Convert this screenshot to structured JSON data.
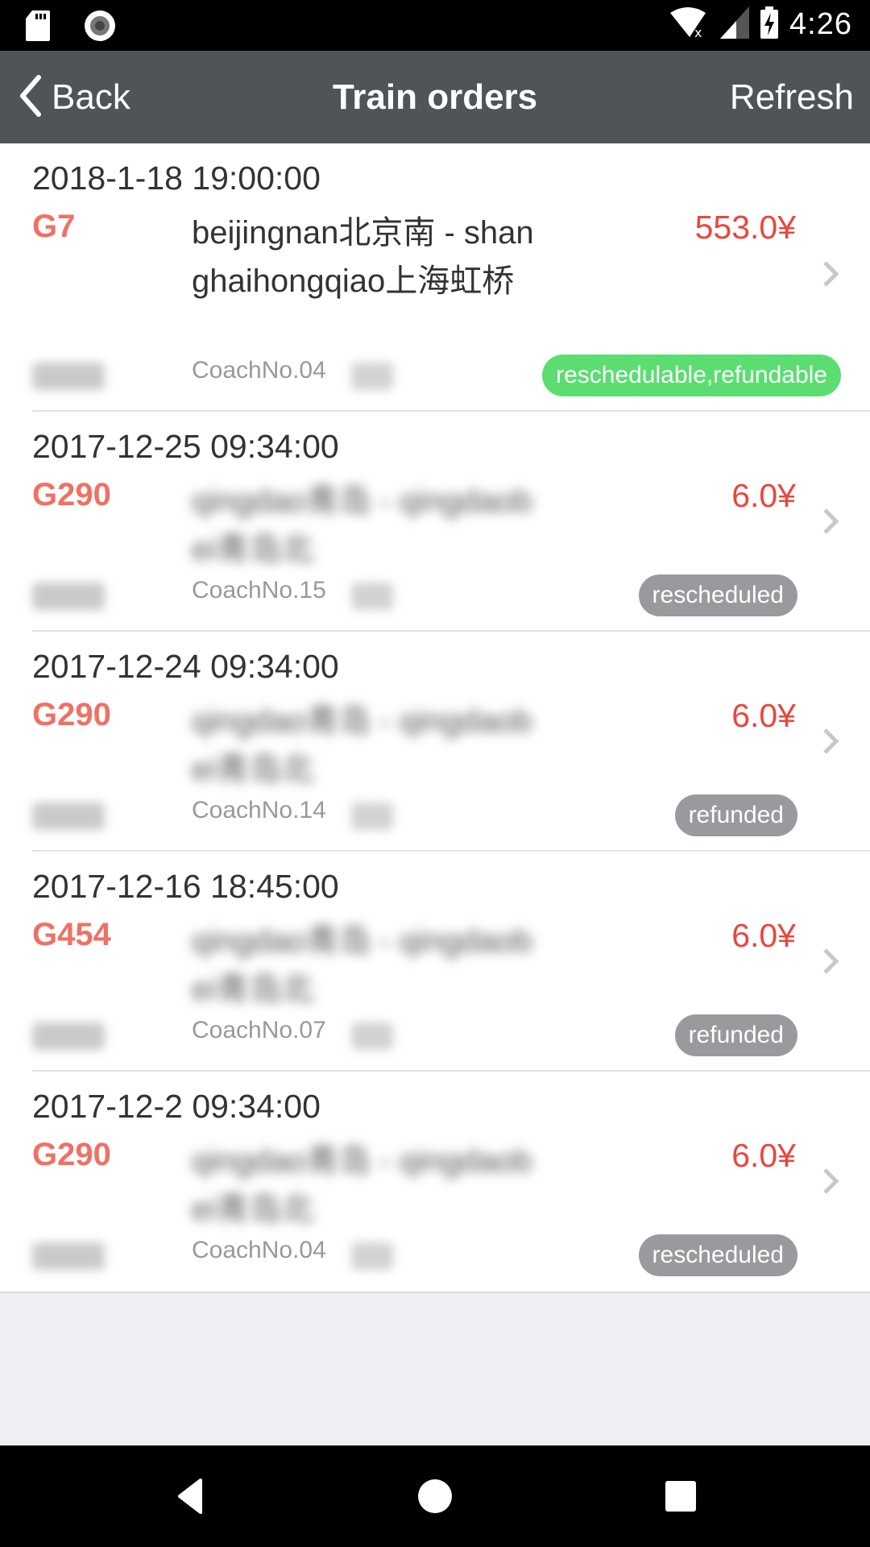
{
  "status_bar": {
    "time": "4:26",
    "icons": [
      "sd-card-icon",
      "record-icon",
      "wifi-off-icon",
      "signal-icon",
      "battery-charging-icon"
    ]
  },
  "header": {
    "back_label": "Back",
    "title": "Train orders",
    "refresh_label": "Refresh"
  },
  "colors": {
    "header_bg": "#4f5458",
    "train_no": "#f07064",
    "price": "#e8473d",
    "badge_green": "#5cdd72",
    "badge_gray": "#999a9e"
  },
  "orders": [
    {
      "datetime": "2018-1-18 19:00:00",
      "train_no": "G7",
      "route": "beijingnan北京南 - shanghaihongqiao上海虹桥",
      "route_blurred": false,
      "price": "553.0¥",
      "coach": "CoachNo.04",
      "status": "reschedulable,refundable",
      "status_color": "green"
    },
    {
      "datetime": "2017-12-25 09:34:00",
      "train_no": "G290",
      "route": "qingdao青岛 - qingdaobei青岛北",
      "route_blurred": true,
      "price": "6.0¥",
      "coach": "CoachNo.15",
      "status": "rescheduled",
      "status_color": "gray"
    },
    {
      "datetime": "2017-12-24 09:34:00",
      "train_no": "G290",
      "route": "qingdao青岛 - qingdaobei青岛北",
      "route_blurred": true,
      "price": "6.0¥",
      "coach": "CoachNo.14",
      "status": "refunded",
      "status_color": "gray"
    },
    {
      "datetime": "2017-12-16 18:45:00",
      "train_no": "G454",
      "route": "qingdao青岛 - qingdaobei青岛北",
      "route_blurred": true,
      "price": "6.0¥",
      "coach": "CoachNo.07",
      "status": "refunded",
      "status_color": "gray"
    },
    {
      "datetime": "2017-12-2 09:34:00",
      "train_no": "G290",
      "route": "qingdao青岛 - qingdaobei青岛北",
      "route_blurred": true,
      "price": "6.0¥",
      "coach": "CoachNo.04",
      "status": "rescheduled",
      "status_color": "gray"
    }
  ],
  "nav_bar": {
    "buttons": [
      "back-nav",
      "home-nav",
      "recents-nav"
    ]
  }
}
